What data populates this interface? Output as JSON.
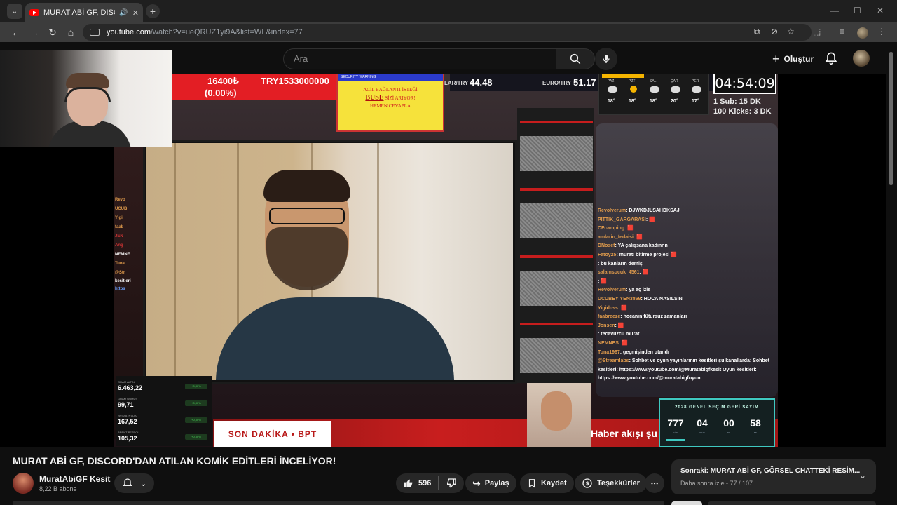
{
  "browser": {
    "tab_title": "MURAT ABİ GF, DISCORD'DAN",
    "url_host": "youtube.com",
    "url_path": "/watch?v=ueQRUZ1yi9A&list=WL&index=77"
  },
  "header": {
    "search_placeholder": "Ara",
    "create_label": "Oluştur"
  },
  "overlay": {
    "ticker_price": "16400₺",
    "ticker_pct": "(0.00%)",
    "ticker_try": "TRY1533000000",
    "usd_label": "LAR/TRY",
    "usd_value": "44.48",
    "eur_label": "EURO/TRY",
    "eur_value": "51.17",
    "warn_bar": "SECURITY WARNING",
    "warn_line1": "ACİL BAĞLANTI İSTEĞİ",
    "warn_big": "BUSE",
    "warn_line2": "SİZİ ARIYOR!",
    "warn_line3": "HEMEN CEVAPLA",
    "weather_days": [
      "PAZ",
      "PZT",
      "SAL",
      "ÇAR",
      "PER"
    ],
    "weather_temps": [
      "18°",
      "18°",
      "18°",
      "20°",
      "17°"
    ],
    "timer": "04:54:09",
    "goal1": "1 Sub: 15 DK",
    "goal2": "100 Kicks: 3 DK",
    "son_dakika": "SON DAKİKA • BPT",
    "haber": "Haber akışı şu",
    "countdown_title": "2028 GENEL SEÇİM GERİ SAYIM",
    "countdown": [
      "777",
      "04",
      "00",
      "58"
    ],
    "countdown_labels": [
      "GÜN",
      "SAAT",
      "DK",
      "SN"
    ],
    "stocks": [
      {
        "label": "GRAM ALTIN",
        "value": "6.463,22",
        "pct": "+0,00%"
      },
      {
        "label": "GRAM GÜMÜŞ",
        "value": "99,71",
        "pct": "+0,00%"
      },
      {
        "label": "NVIDIA (NVDA)",
        "value": "167,52",
        "pct": "+0,00%"
      },
      {
        "label": "BRENT PETROL",
        "value": "105,32",
        "pct": "+0,00%"
      }
    ],
    "left_names": [
      "Revo",
      "UCUB",
      "Yigi",
      "faab",
      "JEN",
      "Ang",
      "NEMNE",
      "Tuna",
      "@Str",
      "kesitleri",
      "https"
    ]
  },
  "chat": [
    {
      "user": "Revolverum",
      "msg": ": DJWKDJLSAHDKSAJ"
    },
    {
      "user": "PITTIK_GARGARASI",
      "msg": ": 🟥"
    },
    {
      "user": "CFcamping",
      "msg": ": 🟥"
    },
    {
      "user": "amlarin_fedaisi",
      "msg": ": 🟥"
    },
    {
      "user": "DNosef",
      "msg": ": YA çalışsana kadınnn"
    },
    {
      "user": "Fatoy25",
      "msg": ": muratı bitirme projesi 🟥"
    },
    {
      "user": "",
      "msg": ": bu kanların demiş"
    },
    {
      "user": "salamsucuk_4561",
      "msg": ": 🟥"
    },
    {
      "user": "",
      "msg": ": 🟥"
    },
    {
      "user": "Revolverum",
      "msg": ": ya aç izle"
    },
    {
      "user": "UCUBEYIYEN3869",
      "msg": ": HOCA NASILSIN"
    },
    {
      "user": "Yigidoss",
      "msg": ": 🟥"
    },
    {
      "user": "faabreeze",
      "msg": ": hocanın fütursuz zamanları"
    },
    {
      "user": "Jonsen",
      "msg": ": 🟥"
    },
    {
      "user": "",
      "msg": ": tecavuzcu murat"
    },
    {
      "user": "NEMNES",
      "msg": ": 🟥"
    },
    {
      "user": "Tuna1967",
      "msg": ": geçmişinden utandı"
    },
    {
      "user": "@Streamlabs",
      "msg": ": Sohbet ve oyun yayınlarının kesitleri şu kanallarda: Sohbet"
    },
    {
      "user": "",
      "msg": "kesitleri: https://www.youtube.com/@Muratabigfkesit Oyun kesitleri:"
    },
    {
      "user": "",
      "msg": "https://www.youtube.com/@muratabigfoyun"
    }
  ],
  "video": {
    "title": "MURAT ABİ GF, DISCORD'DAN ATILAN KOMİK EDİTLERİ İNCELİYOR!",
    "channel": "MuratAbiGF Kesit",
    "subs": "8,22 B abone",
    "likes": "596",
    "share": "Paylaş",
    "save": "Kaydet",
    "thanks": "Teşekkürler"
  },
  "next": {
    "title": "Sonraki: MURAT ABİ GF, GÖRSEL CHATTEKİ RESİM...",
    "sub": "Daha sonra izle - 77 / 107"
  }
}
